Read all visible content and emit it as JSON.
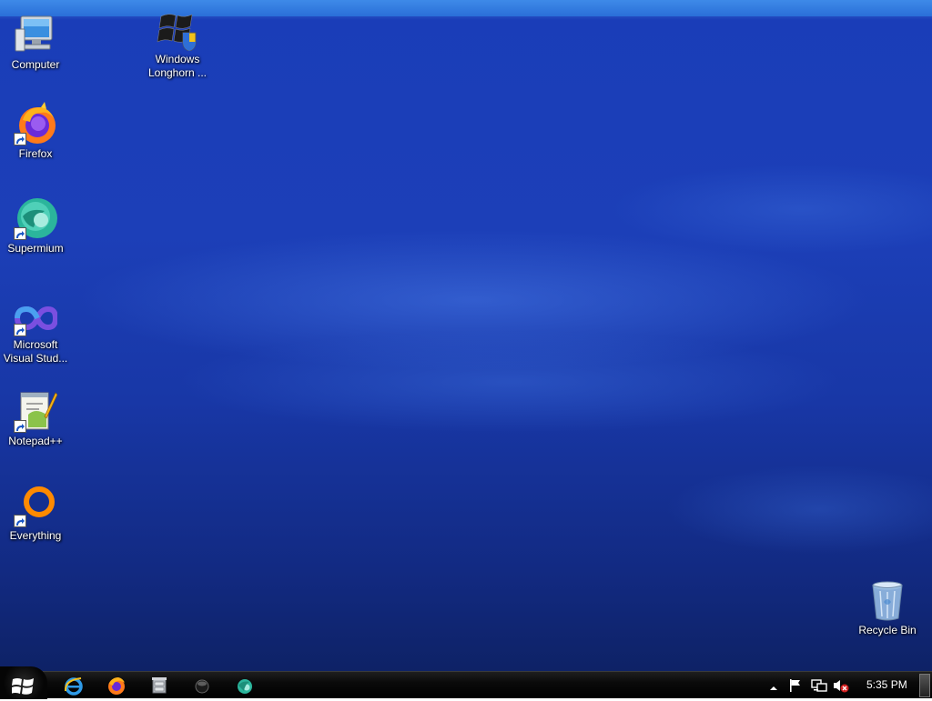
{
  "desktop": {
    "icons": [
      {
        "name": "computer",
        "label": "Computer",
        "icon": "computer-icon"
      },
      {
        "name": "windows-longhorn",
        "label": "Windows Longhorn ...",
        "icon": "windows-flag-icon"
      },
      {
        "name": "firefox",
        "label": "Firefox",
        "icon": "firefox-icon"
      },
      {
        "name": "supermium",
        "label": "Supermium",
        "icon": "supermium-icon"
      },
      {
        "name": "visual-studio",
        "label": "Microsoft Visual Stud...",
        "icon": "visual-studio-icon"
      },
      {
        "name": "notepadpp",
        "label": "Notepad++",
        "icon": "notepadpp-icon"
      },
      {
        "name": "everything",
        "label": "Everything",
        "icon": "everything-icon"
      },
      {
        "name": "recycle-bin",
        "label": "Recycle Bin",
        "icon": "recycle-bin-icon"
      }
    ]
  },
  "taskbar": {
    "start_icon": "windows-logo-icon",
    "pinned": [
      {
        "name": "internet-explorer",
        "icon": "internet-explorer-icon"
      },
      {
        "name": "firefox",
        "icon": "firefox-icon"
      },
      {
        "name": "file-manager",
        "icon": "cabinet-icon"
      },
      {
        "name": "media",
        "icon": "dark-orb-icon"
      },
      {
        "name": "supermium",
        "icon": "supermium-icon"
      }
    ],
    "tray": {
      "icons": [
        "show-hidden-icons-icon",
        "action-center-flag-icon",
        "network-icon",
        "volume-muted-icon"
      ],
      "clock": "5:35 PM"
    }
  },
  "colors": {
    "wallpaper_base": "#1a3db8",
    "taskbar": "#0a0a0a",
    "label_text": "#ffffff"
  }
}
